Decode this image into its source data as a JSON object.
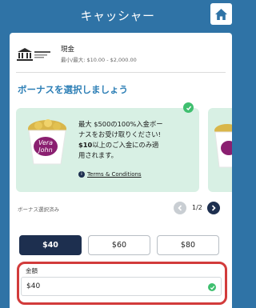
{
  "header": {
    "title": "キャッシャー",
    "home_icon": "home-icon"
  },
  "payment_method": {
    "logo_icon": "bank-transfer-logo",
    "name": "現金",
    "limit": "最小/最大: $10.00 - $2,000.00"
  },
  "bonus": {
    "heading": "ボーナスを選択しましょう",
    "card": {
      "line1": "最大 $500の100%入金ボー",
      "line2": "ナスをお受け取りください!",
      "line3_bold": "$10",
      "line3_rest": "以上のご入金にのみ適",
      "line4": "用されます。",
      "terms": "Terms & Conditions",
      "image_icon": "vera-john-coin-cup-image",
      "selected": true
    },
    "selected_label": "ボーナス選択済み",
    "pagination": "1/2"
  },
  "amount_options": [
    "$40",
    "$60",
    "$80"
  ],
  "selected_amount_index": 0,
  "amount_field": {
    "label": "金額",
    "value": "$40",
    "valid": true
  },
  "colors": {
    "header": "#2f73a6",
    "accent_heading": "#2d7fb6",
    "navy": "#1d2f4f",
    "bonus_card": "#d8f0e4",
    "success": "#3fbf6f",
    "highlight": "#d23b3b"
  }
}
